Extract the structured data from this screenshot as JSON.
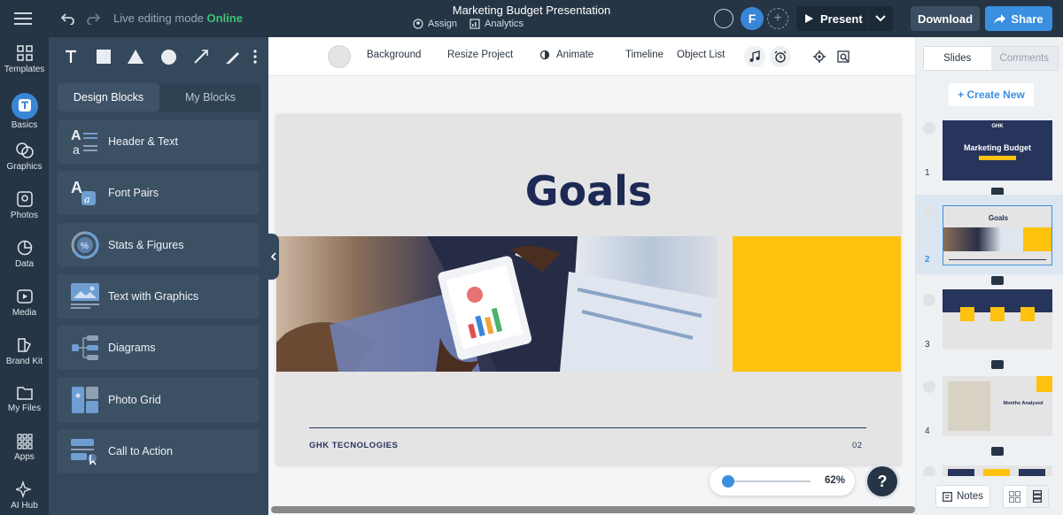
{
  "topbar": {
    "mode_label": "Live editing mode",
    "mode_status": "Online",
    "doc_title": "Marketing Budget Presentation",
    "assign_label": "Assign",
    "analytics_label": "Analytics",
    "avatar_initial": "F",
    "present_label": "Present",
    "download_label": "Download",
    "share_label": "Share"
  },
  "rail": {
    "items": [
      {
        "label": "Templates",
        "icon": "templates-icon"
      },
      {
        "label": "Basics",
        "icon": "basics-icon"
      },
      {
        "label": "Graphics",
        "icon": "graphics-icon"
      },
      {
        "label": "Photos",
        "icon": "photos-icon"
      },
      {
        "label": "Data",
        "icon": "data-icon"
      },
      {
        "label": "Media",
        "icon": "media-icon"
      },
      {
        "label": "Brand Kit",
        "icon": "brand-kit-icon"
      },
      {
        "label": "My Files",
        "icon": "folder-icon"
      },
      {
        "label": "Apps",
        "icon": "apps-icon"
      },
      {
        "label": "AI Hub",
        "icon": "sparkle-icon"
      }
    ],
    "active": "Basics"
  },
  "panel": {
    "tabs": [
      "Design Blocks",
      "My Blocks"
    ],
    "active_tab": "Design Blocks",
    "blocks": [
      "Header & Text",
      "Font Pairs",
      "Stats & Figures",
      "Text with Graphics",
      "Diagrams",
      "Photo Grid",
      "Call to Action"
    ]
  },
  "canvas_toolbar": {
    "background": "Background",
    "resize": "Resize Project",
    "animate": "Animate",
    "timeline": "Timeline",
    "object_list": "Object List"
  },
  "slide": {
    "title": "Goals",
    "company": "GHK TECNOLOGIES",
    "page_number": "02"
  },
  "zoom": {
    "percent": "62%",
    "value": 0.62
  },
  "help_label": "?",
  "right_panel": {
    "tabs": [
      "Slides",
      "Comments"
    ],
    "active_tab": "Slides",
    "create_new": "+ Create New",
    "thumbnails": [
      {
        "num": "1",
        "title": "Marketing Budget",
        "brand": "GHK"
      },
      {
        "num": "2",
        "title": "Goals"
      },
      {
        "num": "3"
      },
      {
        "num": "4",
        "title": "Months Analyzed"
      }
    ],
    "active_slide": "2",
    "notes_label": "Notes"
  },
  "colors": {
    "accent": "#3a8fe0",
    "online": "#3fc27a",
    "slide_navy": "#1d2a55",
    "slide_yellow": "#ffc20e"
  }
}
